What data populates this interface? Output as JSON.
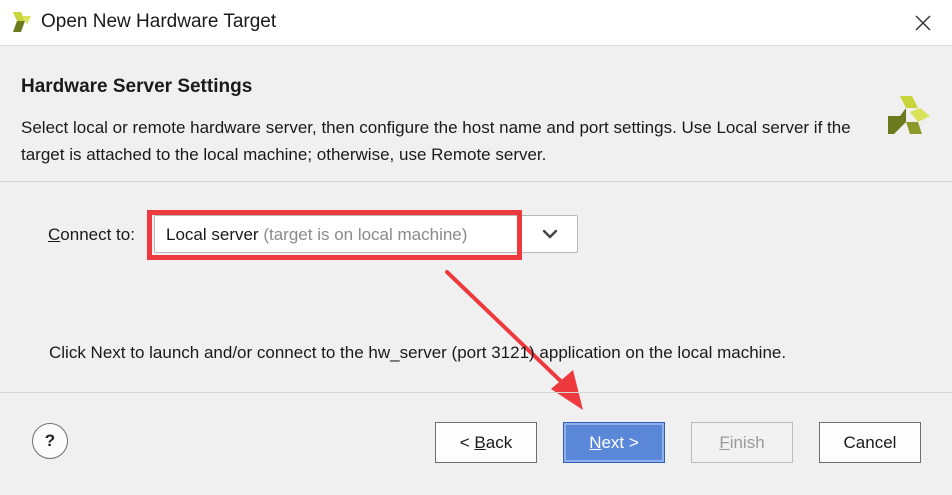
{
  "window": {
    "title": "Open New Hardware Target",
    "close_icon": "close-icon"
  },
  "header": {
    "title": "Hardware Server Settings",
    "description": "Select local or remote hardware server, then configure the host name and port settings. Use Local server if the target is attached to the local machine; otherwise, use Remote server."
  },
  "connect": {
    "label_mnemonic": "C",
    "label_rest": "onnect to:",
    "selected_main": "Local server",
    "selected_hint": " (target is on local machine)"
  },
  "info": {
    "text": "Click Next to launch and/or connect to the hw_server (port 3121) application on the local machine."
  },
  "footer": {
    "help_label": "?",
    "back_prefix": "< ",
    "back_mnemonic": "B",
    "back_rest": "ack",
    "next_mnemonic": "N",
    "next_rest": "ext >",
    "finish_mnemonic": "F",
    "finish_rest": "inish",
    "cancel_label": "Cancel"
  },
  "colors": {
    "logo_green_light": "#c7d53a",
    "logo_green_dark": "#6c7a1f",
    "annotation_red": "#ee3a3f",
    "primary_button": "#5b87d8"
  }
}
